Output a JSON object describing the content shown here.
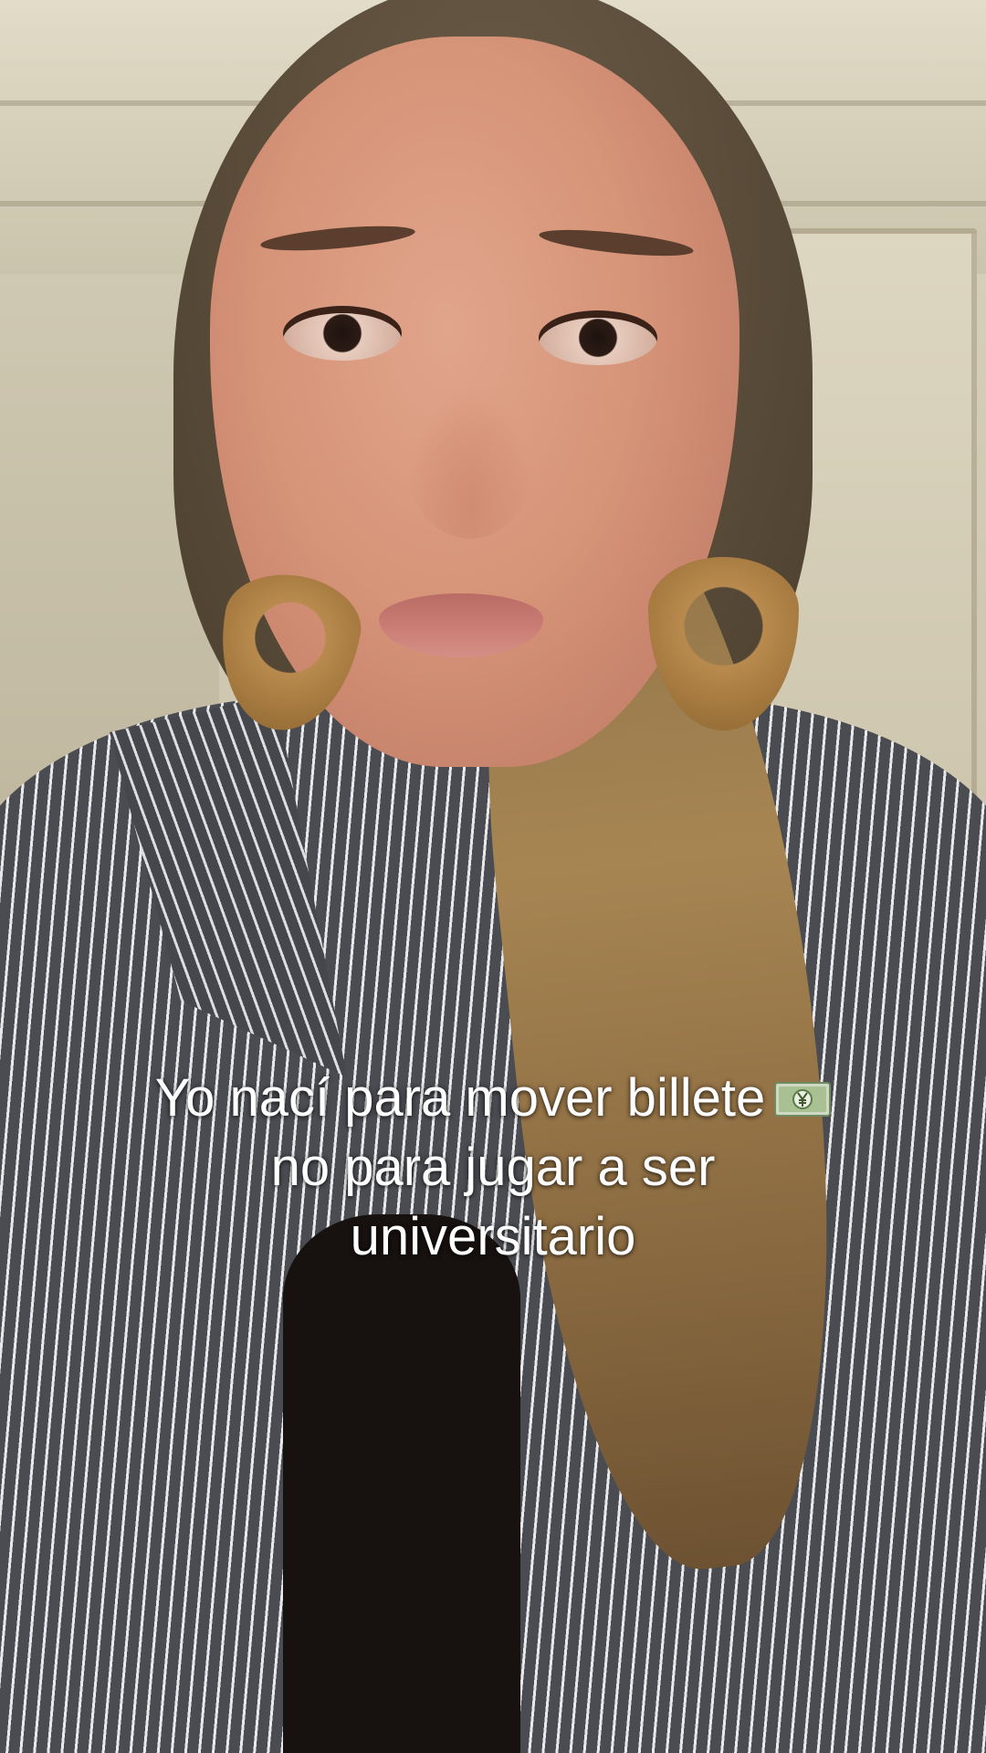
{
  "caption": {
    "line1": "Yo nací para mover billete",
    "line2": "no para jugar a ser",
    "line3": "universitario",
    "emoji_icon": "money-with-yen-icon"
  }
}
